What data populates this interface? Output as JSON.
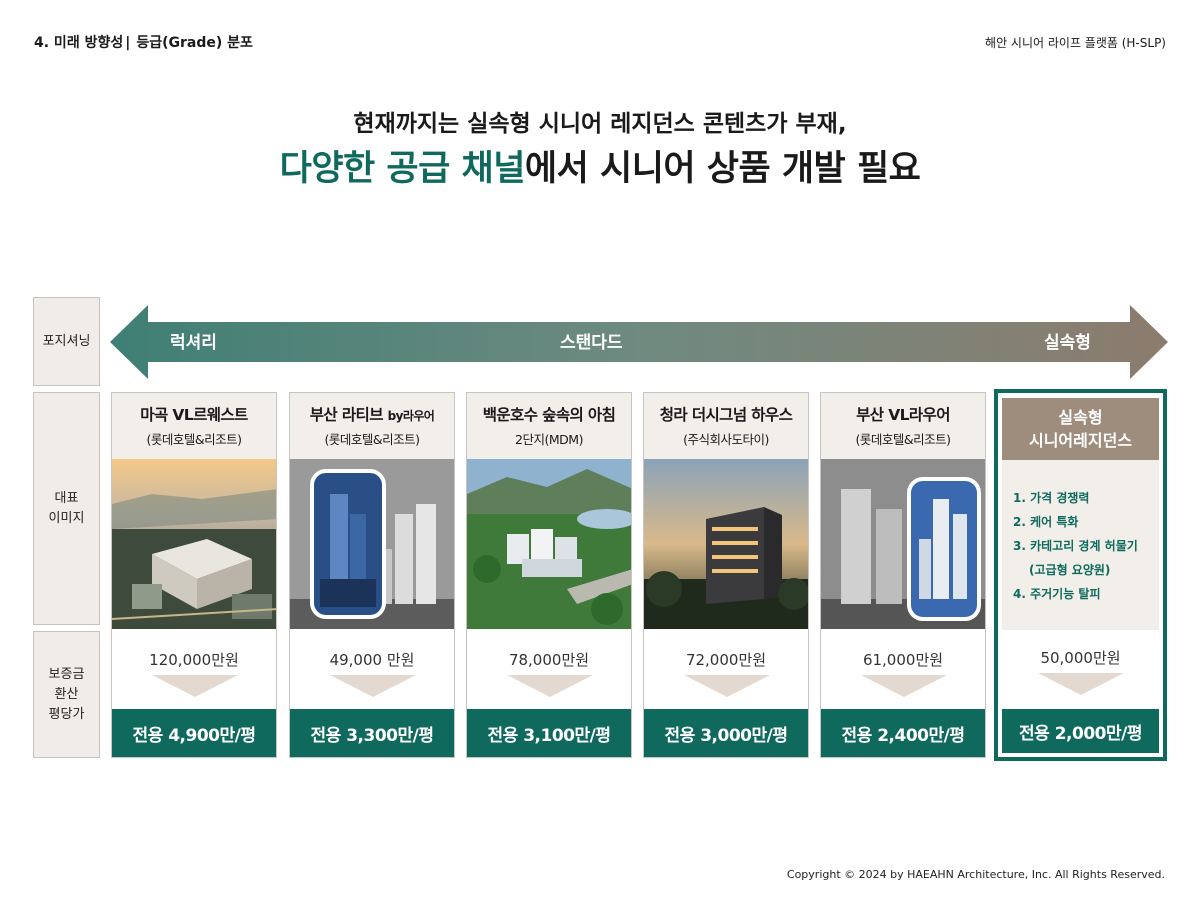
{
  "header": {
    "section": "4. 미래 방향성",
    "separator": "|",
    "subsection": "등급(Grade) 분포",
    "platform": "해안 시니어 라이프 플랫폼 (H-SLP)"
  },
  "headline": {
    "line1": "현재까지는 실속형 시니어 레지던스 콘텐츠가 부재,",
    "line2_accent": "다양한 공급 채널",
    "line2_rest": "에서 시니어 상품 개발 필요"
  },
  "row_labels": {
    "positioning": "포지셔닝",
    "image_line1": "대표",
    "image_line2": "이미지",
    "price_line1": "보증금",
    "price_line2": "환산",
    "price_line3": "평당가"
  },
  "positioning_scale": {
    "luxury": "럭셔리",
    "standard": "스탠다드",
    "value": "실속형"
  },
  "products": [
    {
      "title": "마곡 VL르웨스트",
      "title_suffix": "",
      "subtitle": "(롯데호텔&리조트)",
      "deposit": "120,000만원",
      "per_pyeong": "전용 4,900만/평"
    },
    {
      "title": "부산 라티브 ",
      "title_suffix": "by라우어",
      "subtitle": "(롯데호텔&리조트)",
      "deposit": "49,000 만원",
      "per_pyeong": "전용 3,300만/평"
    },
    {
      "title": "백운호수 숲속의 아침",
      "title_suffix": "",
      "subtitle": "2단지(MDM)",
      "deposit": "78,000만원",
      "per_pyeong": "전용 3,100만/평"
    },
    {
      "title": "청라 더시그넘 하우스",
      "title_suffix": "",
      "subtitle": "(주식회사도타이)",
      "deposit": "72,000만원",
      "per_pyeong": "전용 3,000만/평"
    },
    {
      "title": "부산 VL라우어",
      "title_suffix": "",
      "subtitle": "(롯데호텔&리조트)",
      "deposit": "61,000만원",
      "per_pyeong": "전용 2,400만/평"
    }
  ],
  "proposal": {
    "title_line1": "실속형",
    "title_line2": "시니어레지던스",
    "points": [
      "1. 가격 경쟁력",
      "2. 케어 특화",
      "3. 카테고리 경계 허물기",
      "(고급형 요양원)",
      "4. 주거기능 탈피"
    ],
    "deposit": "50,000만원",
    "per_pyeong": "전용 2,000만/평"
  },
  "footer": {
    "copyright": "Copyright © 2024 by HAEAHN Architecture, Inc. All Rights Reserved."
  },
  "colors": {
    "accent_green": "#0f6a5d",
    "label_beige": "#f1ece8",
    "proposal_brown": "#9e8c7d",
    "arrow_gradient_start": "#3f7f75",
    "arrow_gradient_end": "#8c7c6e",
    "down_arrow": "#e3d9d0"
  },
  "icons": {
    "positioning_arrow": "double-headed-arrow",
    "price_down_arrow": "triangle-down-icon"
  }
}
